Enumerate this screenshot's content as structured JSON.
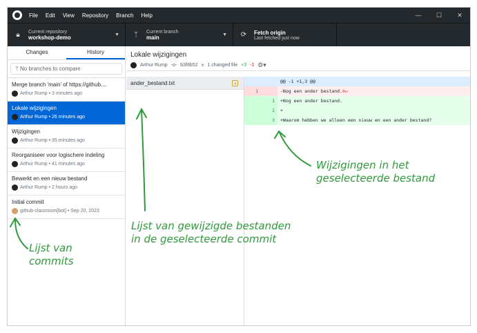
{
  "menu": [
    "File",
    "Edit",
    "View",
    "Repository",
    "Branch",
    "Help"
  ],
  "window_controls": [
    "—",
    "☐",
    "✕"
  ],
  "toolbar": {
    "repo_label": "Current repository",
    "repo": "workshop-demo",
    "branch_label": "Current branch",
    "branch": "main",
    "fetch_label": "Fetch origin",
    "fetch_sub": "Last fetched just now"
  },
  "tabs": {
    "changes": "Changes",
    "history": "History"
  },
  "compare_placeholder": "No branches to compare",
  "commits": [
    {
      "title": "Merge branch 'main' of https://github....",
      "author": "Arthur Rump",
      "time": "3 minutes ago"
    },
    {
      "title": "Lokale wijzigingen",
      "author": "Arthur Rump",
      "time": "26 minutes ago"
    },
    {
      "title": "Wijzigingen",
      "author": "Arthur Rump",
      "time": "35 minutes ago"
    },
    {
      "title": "Reorganiseer voor logischere indeling",
      "author": "Arthur Rump",
      "time": "41 minutes ago"
    },
    {
      "title": "Bewerkt en een nieuw bestand",
      "author": "Arthur Rump",
      "time": "2 hours ago"
    },
    {
      "title": "Initial commit",
      "author": "github-classroom[bot]",
      "time": "Sep 20, 2023"
    }
  ],
  "selected_commit": {
    "title": "Lokale wijzigingen",
    "author": "Arthur Rump",
    "sha": "b3f8b52",
    "changed": "1 changed file",
    "added": "+3",
    "removed": "-1"
  },
  "files": [
    "ander_bestand.txt"
  ],
  "diff": {
    "hunk": "@@ -1 +1,3 @@",
    "lines": [
      {
        "old": "1",
        "new": "",
        "text": "-Nog een ander bestand."
      },
      {
        "old": "",
        "new": "1",
        "text": "+Nog een ander bestand."
      },
      {
        "old": "",
        "new": "2",
        "text": "+"
      },
      {
        "old": "",
        "new": "3",
        "text": "+Waarom hebben we alleen een nieuw en een ander bestand?"
      }
    ]
  },
  "annotations": {
    "diff": "Wijzigingen in het geselecteerde bestand",
    "files": "Lijst van gewijzigde bestanden in de geselecteerde commit",
    "commits": "Lijst van commits"
  }
}
